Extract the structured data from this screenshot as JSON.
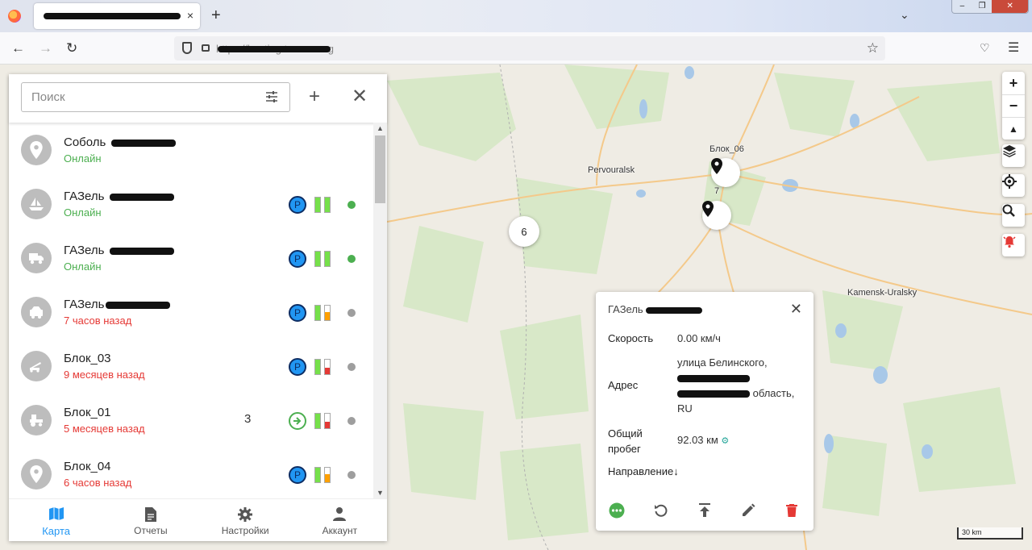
{
  "browser": {
    "tab_close": "×",
    "new_tab": "+",
    "url": "https://hosting.traccar.org",
    "nav": {
      "back": "←",
      "forward": "→",
      "reload": "↻"
    }
  },
  "search": {
    "placeholder": "Поиск",
    "add": "+",
    "close": "✕"
  },
  "devices": [
    {
      "name": "Соболь",
      "status": "Онлайн",
      "state": "online",
      "icon": "pin-icon",
      "indicators": false
    },
    {
      "name": "ГАЗель",
      "status": "Онлайн",
      "state": "online",
      "icon": "boat-icon",
      "indicators": true,
      "battery": 1.0,
      "dot": "#4caf50"
    },
    {
      "name": "ГАЗель",
      "status": "Онлайн",
      "state": "online",
      "icon": "truck-icon",
      "indicators": true,
      "battery": 1.0,
      "dot": "#4caf50"
    },
    {
      "name": "ГАЗель",
      "status": "7 часов назад",
      "state": "offline",
      "icon": "bus-icon",
      "indicators": true,
      "battery": 0.6,
      "dot": "#9e9e9e"
    },
    {
      "name": "Блок_03",
      "status": "9 месяцев назад",
      "state": "offline",
      "icon": "crane-icon",
      "indicators": true,
      "battery": 0.3,
      "dot": "#9e9e9e"
    },
    {
      "name": "Блок_01",
      "status": "5 месяцев назад",
      "state": "offline",
      "icon": "tractor-icon",
      "indicators": true,
      "count": "3",
      "moving": true,
      "battery": 0.3,
      "dot": "#9e9e9e"
    },
    {
      "name": "Блок_04",
      "status": "6 часов назад",
      "state": "offline",
      "icon": "pin-icon",
      "indicators": true,
      "battery": 0.6,
      "dot": "#9e9e9e"
    }
  ],
  "nav": [
    {
      "label": "Карта",
      "icon": "map-icon",
      "active": true
    },
    {
      "label": "Отчеты",
      "icon": "report-icon"
    },
    {
      "label": "Настройки",
      "icon": "settings-icon"
    },
    {
      "label": "Аккаунт",
      "icon": "account-icon"
    }
  ],
  "map": {
    "labels": {
      "pervouralsk": "Pervouralsk",
      "kamensk": "Kamensk-Uralsky",
      "blok06": "Блок_06",
      "seven": "7"
    },
    "cluster": "6",
    "scale": "30 km"
  },
  "popup": {
    "title": "ГАЗель",
    "speed_label": "Скорость",
    "speed_value": "0.00 км/ч",
    "address_label": "Адрес",
    "address_line1": "улица Белинского,",
    "address_line2_suffix": "область,",
    "address_line3": "RU",
    "mileage_label_1": "Общий",
    "mileage_label_2": "пробег",
    "mileage_value": "92.03 км",
    "direction_label": "Направление",
    "direction_value": "↓"
  }
}
